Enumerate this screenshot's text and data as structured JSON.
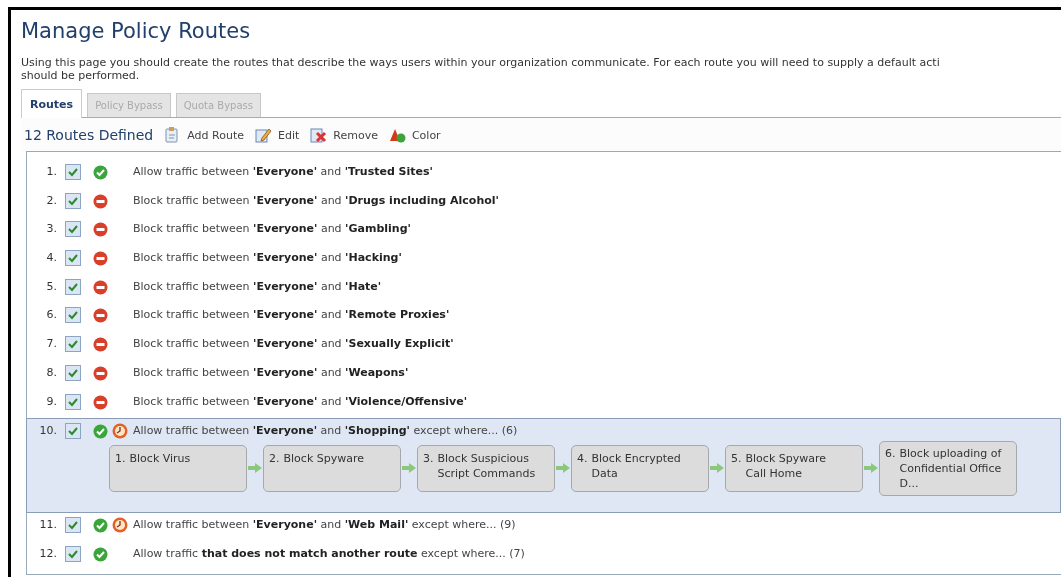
{
  "title": "Manage Policy Routes",
  "description": [
    "Using this page you should create the routes that describe the ways users within your organization communicate. For each route you will need to supply a default acti",
    "should be performed."
  ],
  "tabs": [
    {
      "label": "Routes",
      "selected": true
    },
    {
      "label": "Policy Bypass",
      "selected": false
    },
    {
      "label": "Quota Bypass",
      "selected": false
    }
  ],
  "toolbar": {
    "count": "12 Routes Defined",
    "actions": [
      {
        "kind": "add",
        "label": "Add Route"
      },
      {
        "kind": "edit",
        "label": "Edit"
      },
      {
        "kind": "remove",
        "label": "Remove"
      },
      {
        "kind": "color",
        "label": "Color"
      }
    ]
  },
  "routes": [
    {
      "number": "1.",
      "checked": true,
      "kind": "allow",
      "scheduled": false,
      "selected": false,
      "text": "Allow traffic between **'Everyone'** and **'Trusted Sites'**"
    },
    {
      "number": "2.",
      "checked": true,
      "kind": "block",
      "scheduled": false,
      "selected": false,
      "text": "Block traffic between **'Everyone'** and **'Drugs including Alcohol'**"
    },
    {
      "number": "3.",
      "checked": true,
      "kind": "block",
      "scheduled": false,
      "selected": false,
      "text": "Block traffic between **'Everyone'** and **'Gambling'**"
    },
    {
      "number": "4.",
      "checked": true,
      "kind": "block",
      "scheduled": false,
      "selected": false,
      "text": "Block traffic between **'Everyone'** and **'Hacking'**"
    },
    {
      "number": "5.",
      "checked": true,
      "kind": "block",
      "scheduled": false,
      "selected": false,
      "text": "Block traffic between **'Everyone'** and **'Hate'**"
    },
    {
      "number": "6.",
      "checked": true,
      "kind": "block",
      "scheduled": false,
      "selected": false,
      "text": "Block traffic between **'Everyone'** and **'Remote Proxies'**"
    },
    {
      "number": "7.",
      "checked": true,
      "kind": "block",
      "scheduled": false,
      "selected": false,
      "text": "Block traffic between **'Everyone'** and **'Sexually Explicit'**"
    },
    {
      "number": "8.",
      "checked": true,
      "kind": "block",
      "scheduled": false,
      "selected": false,
      "text": "Block traffic between **'Everyone'** and **'Weapons'**"
    },
    {
      "number": "9.",
      "checked": true,
      "kind": "block",
      "scheduled": false,
      "selected": false,
      "text": "Block traffic between **'Everyone'** and **'Violence/Offensive'**"
    },
    {
      "number": "10.",
      "checked": true,
      "kind": "allow",
      "scheduled": true,
      "selected": true,
      "text": "Allow traffic between **'Everyone'** and **'Shopping'** except where... (6)",
      "steps": [
        {
          "number": "1.",
          "label": "Block Virus"
        },
        {
          "number": "2.",
          "label": "Block Spyware"
        },
        {
          "number": "3.",
          "label": "Block Suspicious Script Commands"
        },
        {
          "number": "4.",
          "label": "Block Encrypted Data"
        },
        {
          "number": "5.",
          "label": "Block Spyware Call Home"
        },
        {
          "number": "6.",
          "label": "Block uploading of Confidential Office D..."
        }
      ]
    },
    {
      "number": "11.",
      "checked": true,
      "kind": "allow",
      "scheduled": true,
      "selected": false,
      "text": "Allow traffic between **'Everyone'** and **'Web Mail'** except where... (9)"
    },
    {
      "number": "12.",
      "checked": true,
      "kind": "allow",
      "scheduled": false,
      "selected": false,
      "text": "Allow traffic **that does not match another route** except where... (7)"
    }
  ]
}
